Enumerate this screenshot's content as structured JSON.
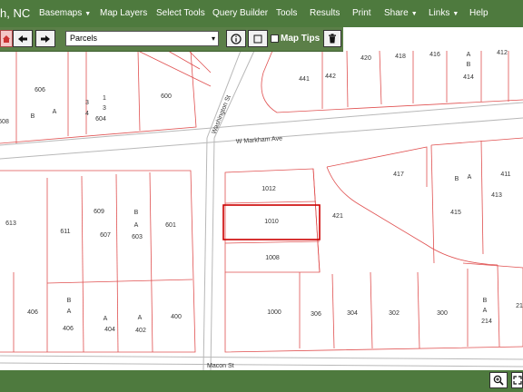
{
  "app": {
    "title": "h, NC"
  },
  "nav": {
    "items": [
      {
        "label": "Basemaps",
        "dropdown": true
      },
      {
        "label": "Map Layers",
        "dropdown": false
      },
      {
        "label": "Select Tools",
        "dropdown": false
      },
      {
        "label": "Query Builder",
        "dropdown": false
      },
      {
        "label": "Tools",
        "dropdown": false
      },
      {
        "label": "Results",
        "dropdown": false
      },
      {
        "label": "Print",
        "dropdown": false
      },
      {
        "label": "Share",
        "dropdown": true
      },
      {
        "label": "Links",
        "dropdown": true
      },
      {
        "label": "Help",
        "dropdown": false
      }
    ]
  },
  "toolbar": {
    "layer_select": {
      "value": "Parcels"
    },
    "map_tips_label": "Map Tips",
    "map_tips_checked": false
  },
  "map": {
    "streets": [
      "Washington St",
      "W Markham Ave",
      "Macon St"
    ],
    "parcels": [
      "606",
      "B",
      "A",
      "3",
      "1",
      "4",
      "3",
      "604",
      "608",
      "600",
      "441",
      "442",
      "420",
      "418",
      "416",
      "A",
      "B",
      "414",
      "412",
      "1012",
      "417",
      "411",
      "B",
      "A",
      "413",
      "415",
      "421",
      "1010",
      "1008",
      "613",
      "611",
      "609",
      "607",
      "B",
      "A",
      "603",
      "601",
      "406",
      "B",
      "A",
      "406",
      "A",
      "404",
      "A",
      "402",
      "400",
      "1000",
      "306",
      "304",
      "302",
      "300",
      "B",
      "A",
      "214",
      "21"
    ]
  },
  "colors": {
    "nav_bg": "#4e7a3e",
    "toolbar_bg": "#5b7f48",
    "parcel_line": "#e05050",
    "selected_parcel": "#cc0000"
  }
}
